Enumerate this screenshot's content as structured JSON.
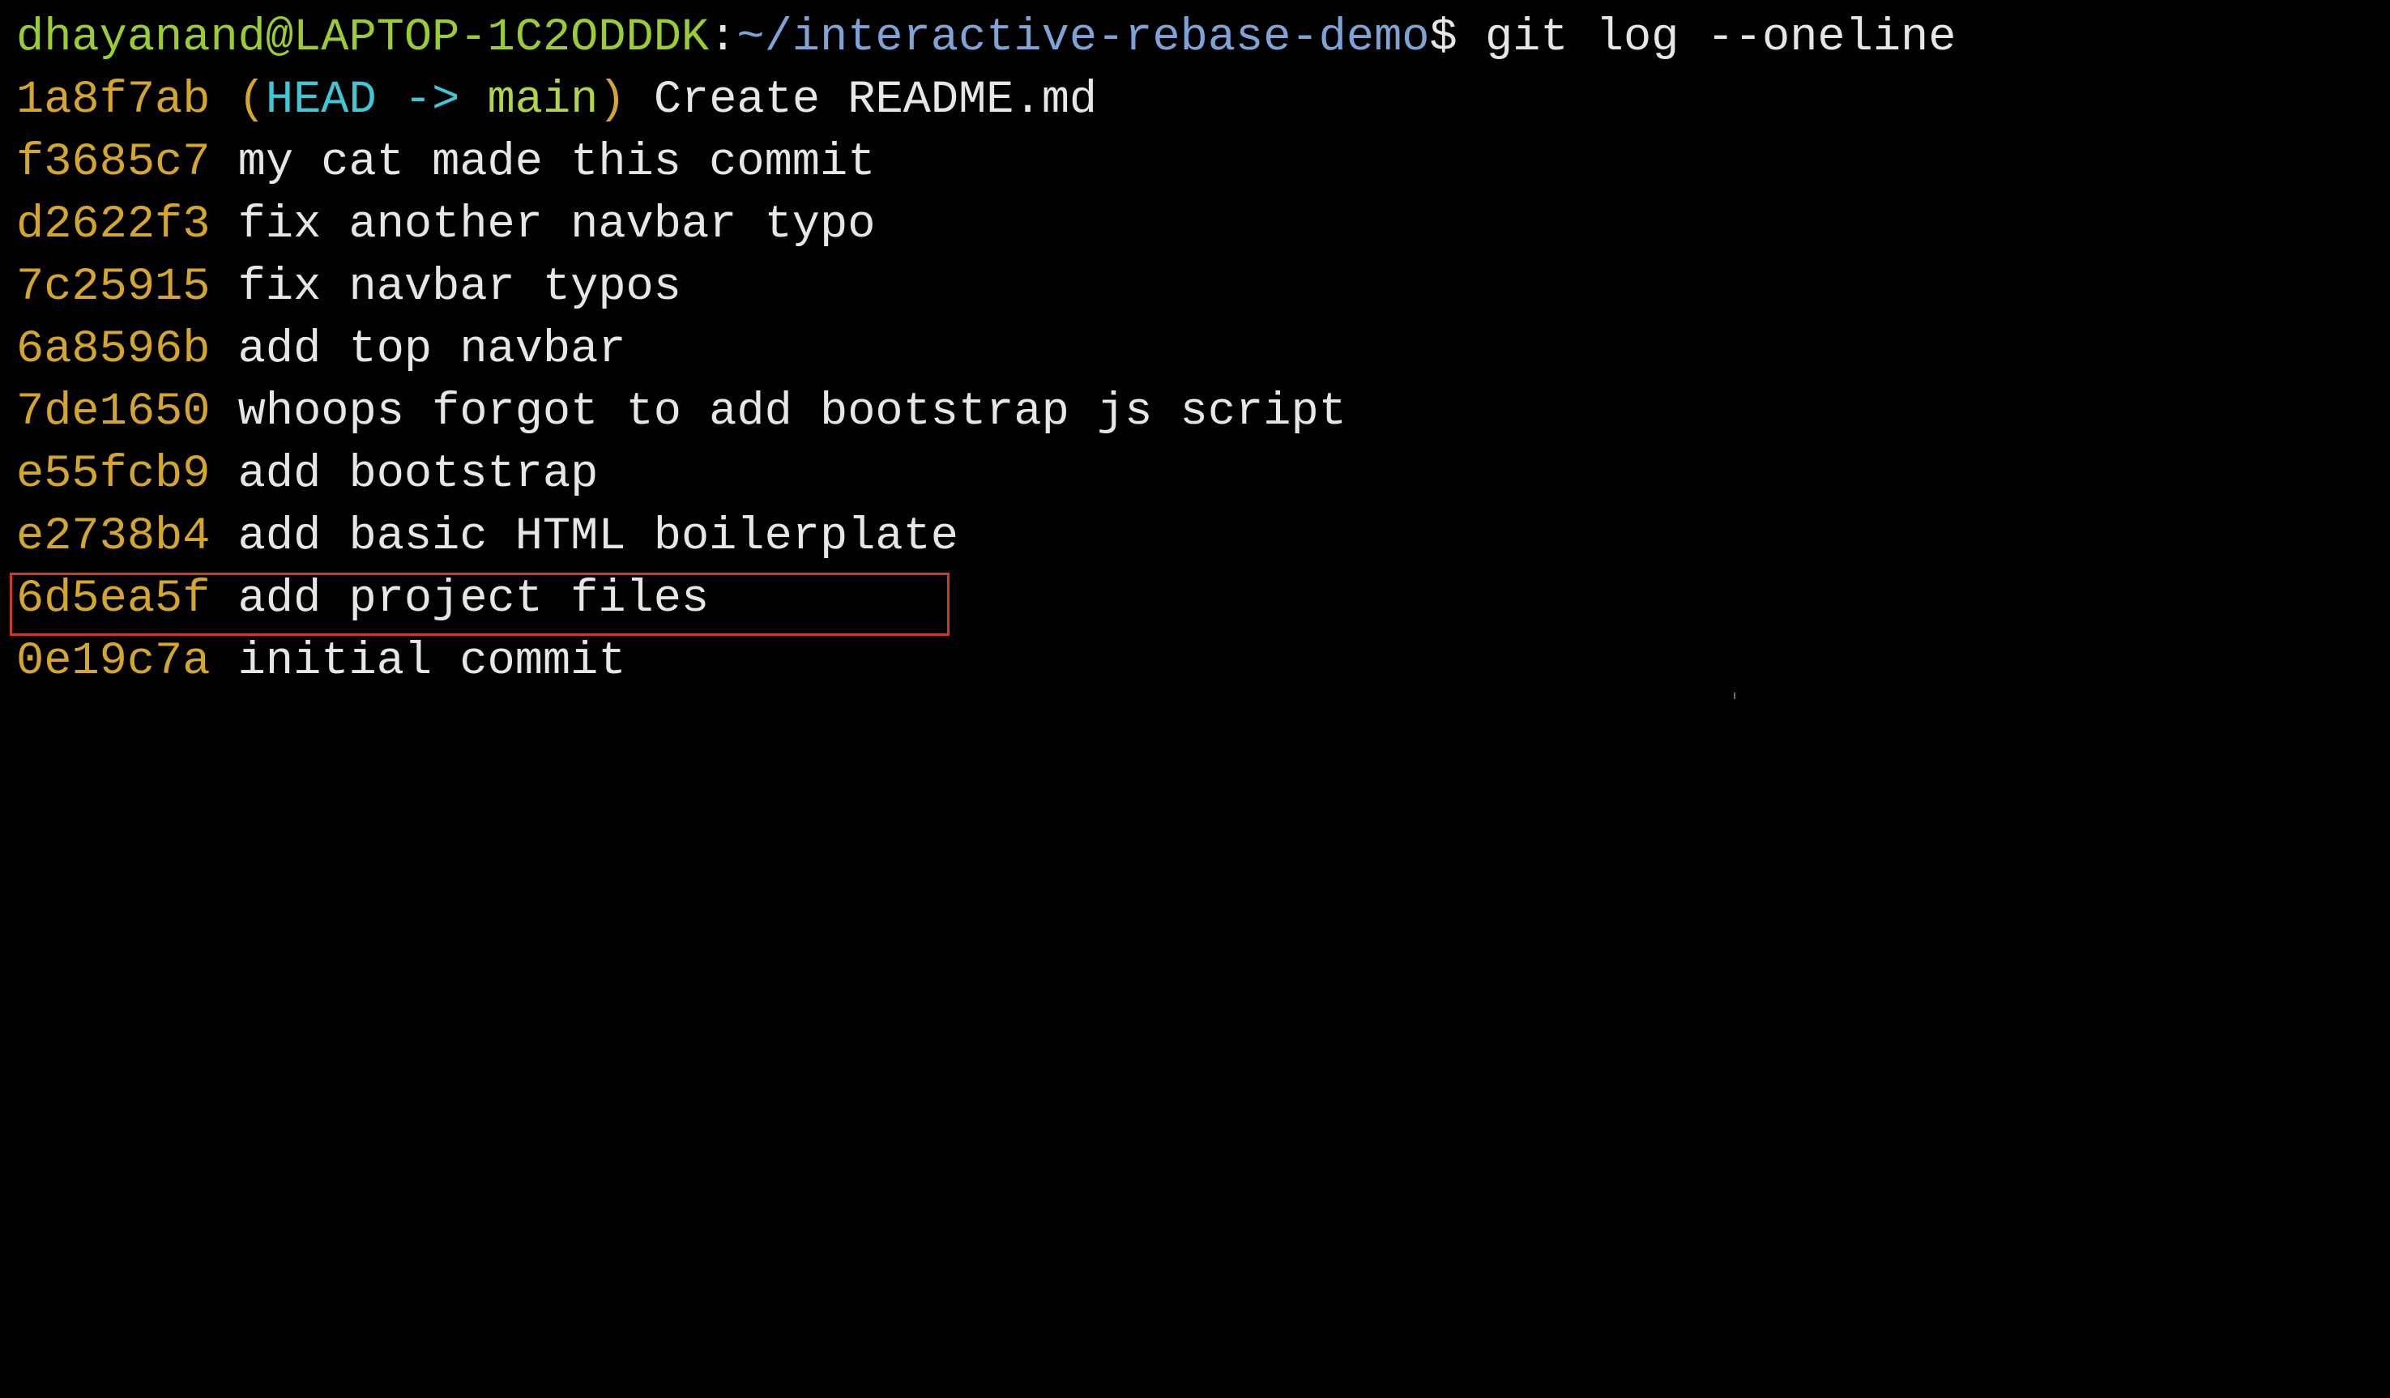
{
  "window": {
    "accent_colors": {
      "user": "#9acd32",
      "path": "#7ea3d6",
      "hash": "#d4a72c",
      "ref_head": "#3ec8d6",
      "ref_branch": "#b0d44a",
      "highlight_border": "#cc3a1f"
    }
  },
  "prompt": {
    "user_host": "dhayanand@LAPTOP-1C2ODDDK",
    "separator": ":",
    "path": "~/interactive-rebase-demo",
    "symbol": "$",
    "command": "git log --oneline"
  },
  "log": {
    "head_ref": {
      "open_paren": "(",
      "head": "HEAD -> ",
      "branch": "main",
      "close_paren": ")"
    },
    "commits": [
      {
        "hash": "1a8f7ab",
        "message": "Create README.md"
      },
      {
        "hash": "f3685c7",
        "message": "my cat made this commit"
      },
      {
        "hash": "d2622f3",
        "message": "fix another navbar typo"
      },
      {
        "hash": "7c25915",
        "message": "fix navbar typos"
      },
      {
        "hash": "6a8596b",
        "message": "add top navbar"
      },
      {
        "hash": "7de1650",
        "message": "whoops forgot to add bootstrap js script"
      },
      {
        "hash": "e55fcb9",
        "message": "add bootstrap"
      },
      {
        "hash": "e2738b4",
        "message": "add basic HTML boilerplate"
      },
      {
        "hash": "6d5ea5f",
        "message": "add project files"
      },
      {
        "hash": "0e19c7a",
        "message": "initial commit"
      }
    ],
    "highlighted_hash": "6d5ea5f"
  }
}
